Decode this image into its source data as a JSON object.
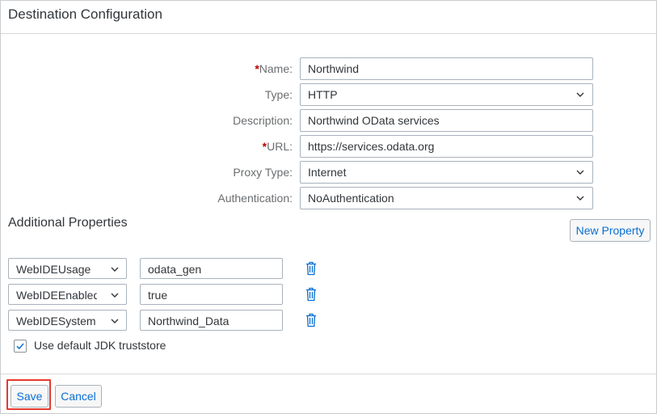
{
  "dialog": {
    "title": "Destination Configuration"
  },
  "form": {
    "name": {
      "required_marker": "*",
      "label": "Name:",
      "value": "Northwind"
    },
    "type": {
      "label": "Type:",
      "value": "HTTP"
    },
    "description": {
      "label": "Description:",
      "value": "Northwind OData services"
    },
    "url": {
      "required_marker": "*",
      "label": "URL:",
      "value": "https://services.odata.org"
    },
    "proxy_type": {
      "label": "Proxy Type:",
      "value": "Internet"
    },
    "authentication": {
      "label": "Authentication:",
      "value": "NoAuthentication"
    }
  },
  "additional": {
    "title": "Additional Properties",
    "new_property_label": "New Property",
    "properties": [
      {
        "key": "WebIDEUsage",
        "value": "odata_gen"
      },
      {
        "key": "WebIDEEnabled",
        "value": "true"
      },
      {
        "key": "WebIDESystem",
        "value": "Northwind_Data"
      }
    ],
    "truststore": {
      "label": "Use default JDK truststore",
      "checked": true
    }
  },
  "footer": {
    "save_label": "Save",
    "cancel_label": "Cancel"
  },
  "icons": {
    "select": "chevron-down-icon",
    "delete": "trash-icon",
    "check": "checkmark-icon"
  },
  "colors": {
    "accent": "#0a6ed1",
    "required": "#bb0000",
    "highlight": "#e8392d"
  }
}
